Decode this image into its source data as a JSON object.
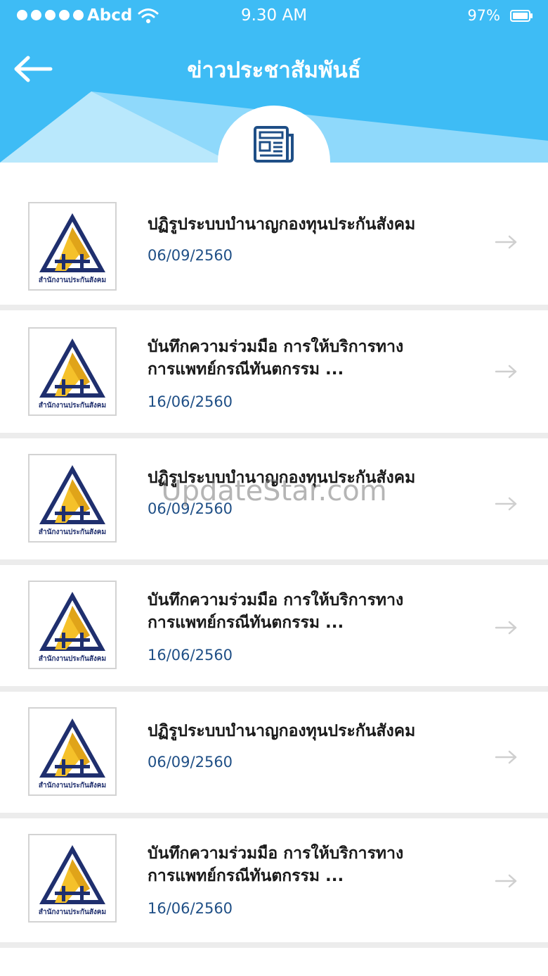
{
  "status_bar": {
    "carrier": "Abcd",
    "time": "9.30 AM",
    "battery": "97%",
    "icons": [
      "signal-dots-icon",
      "wifi-icon",
      "battery-icon"
    ]
  },
  "header": {
    "title": "ข่าวประชาสัมพันธ์",
    "back_icon": "arrow-left-icon",
    "badge_icon": "newspaper-icon"
  },
  "colors": {
    "header_blue": "#3ebcf5",
    "date_blue": "#1f4f86",
    "divider": "#ececec"
  },
  "logo_caption": "สำนักงานประกันสังคม",
  "news": [
    {
      "title": "ปฏิรูประบบบำนาญกองทุนประกันสังคม",
      "title_line2": "",
      "date": "06/09/2560"
    },
    {
      "title": "บันทึกความร่วมมือ การให้บริการทาง",
      "title_line2": "การแพทย์กรณีทันตกรรม ...",
      "date": "16/06/2560"
    },
    {
      "title": "ปฏิรูประบบบำนาญกองทุนประกันสังคม",
      "title_line2": "",
      "date": "06/09/2560"
    },
    {
      "title": "บันทึกความร่วมมือ การให้บริการทาง",
      "title_line2": "การแพทย์กรณีทันตกรรม ...",
      "date": "16/06/2560"
    },
    {
      "title": "ปฏิรูประบบบำนาญกองทุนประกันสังคม",
      "title_line2": "",
      "date": "06/09/2560"
    },
    {
      "title": "บันทึกความร่วมมือ การให้บริการทาง",
      "title_line2": "การแพทย์กรณีทันตกรรม ...",
      "date": "16/06/2560"
    }
  ],
  "watermark": "UpdateStar.com"
}
